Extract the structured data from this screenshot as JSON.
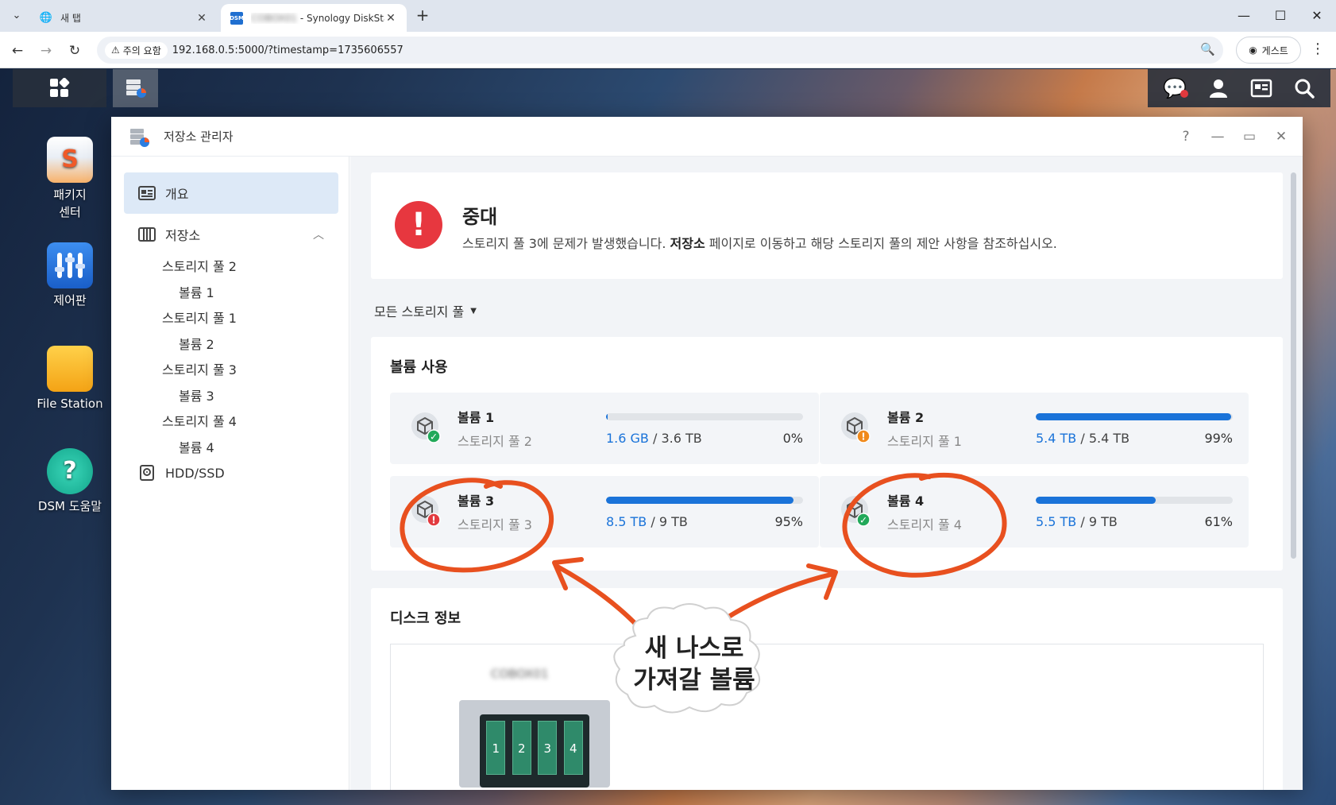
{
  "browser": {
    "tabs": [
      {
        "title": "새 탭"
      },
      {
        "title": " - Synology DiskSta",
        "title_blurred": "COBOX01"
      }
    ],
    "new_tab": "+",
    "security_label": "주의 요함",
    "url": "192.168.0.5:5000/?timestamp=1735606557",
    "profile_label": "게스트"
  },
  "desktop": {
    "icons": [
      {
        "label": "패키지\n센터"
      },
      {
        "label": "제어판"
      },
      {
        "label": "File Station"
      },
      {
        "label": "DSM 도움말"
      }
    ]
  },
  "window": {
    "title": "저장소 관리자",
    "help": "?",
    "minimize": "—",
    "maximize": "▭",
    "close": "✕"
  },
  "sidebar": {
    "overview": "개요",
    "storage": "저장소",
    "tree": [
      {
        "label": "스토리지 풀 2",
        "level": 1
      },
      {
        "label": "볼륨 1",
        "level": 2
      },
      {
        "label": "스토리지 풀 1",
        "level": 1
      },
      {
        "label": "볼륨 2",
        "level": 2
      },
      {
        "label": "스토리지 풀 3",
        "level": 1
      },
      {
        "label": "볼륨 3",
        "level": 2
      },
      {
        "label": "스토리지 풀 4",
        "level": 1
      },
      {
        "label": "볼륨 4",
        "level": 2
      }
    ],
    "hdd": "HDD/SSD"
  },
  "alert": {
    "icon": "!",
    "title": "중대",
    "msg_pre": "스토리지 풀 3에 문제가 발생했습니다. ",
    "msg_bold": "저장소",
    "msg_post": " 페이지로 이동하고 해당 스토리지 풀의 제안 사항을 참조하십시오."
  },
  "filter": {
    "label": "모든 스토리지 풀"
  },
  "volume_usage": {
    "title": "볼륨 사용",
    "volumes": [
      {
        "name": "볼륨 1",
        "pool": "스토리지 풀 2",
        "used": "1.6 GB",
        "total": "3.6 TB",
        "pct": "0%",
        "fill": 0.01,
        "status": "normal",
        "status_color": "#22a95a"
      },
      {
        "name": "볼륨 2",
        "pool": "스토리지 풀 1",
        "used": "5.4 TB",
        "total": "5.4 TB",
        "pct": "99%",
        "fill": 0.99,
        "status": "warning",
        "status_color": "#f08a1c"
      },
      {
        "name": "볼륨 3",
        "pool": "스토리지 풀 3",
        "used": "8.5 TB",
        "total": "9 TB",
        "pct": "95%",
        "fill": 0.95,
        "status": "critical",
        "status_color": "#e23a3f"
      },
      {
        "name": "볼륨 4",
        "pool": "스토리지 풀 4",
        "used": "5.5 TB",
        "total": "9 TB",
        "pct": "61%",
        "fill": 0.61,
        "status": "normal",
        "status_color": "#22a95a"
      }
    ]
  },
  "disk_info": {
    "title": "디스크 정보",
    "nas_name": "COBOX01",
    "bays": [
      "1",
      "2",
      "3",
      "4"
    ]
  },
  "annotation": {
    "line1": "새 나스로",
    "line2": "가져갈 볼륨",
    "color": "#e8501f"
  }
}
